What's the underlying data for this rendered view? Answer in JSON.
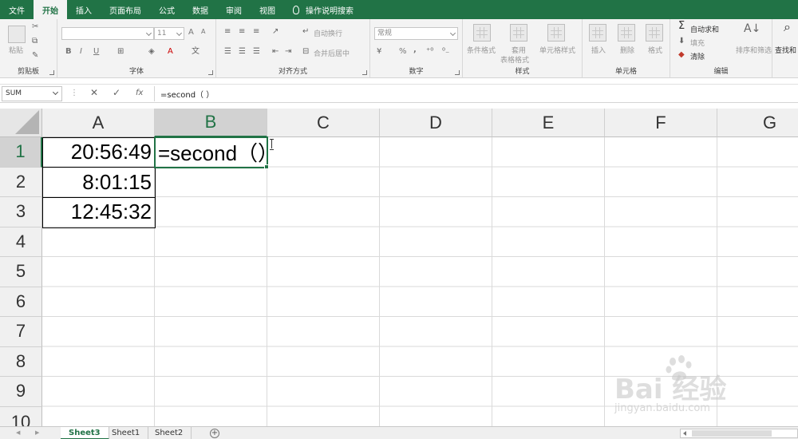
{
  "ribbon": {
    "tabs": [
      "文件",
      "开始",
      "插入",
      "页面布局",
      "公式",
      "数据",
      "审阅",
      "视图",
      "操作说明搜索"
    ],
    "active_tab": "开始",
    "groups": {
      "clipboard": {
        "label": "剪贴板",
        "paste": "粘贴"
      },
      "font": {
        "label": "字体",
        "size": "11",
        "bold": "B",
        "italic": "I",
        "underline": "U",
        "grow": "A",
        "shrink": "A",
        "font_color": "A"
      },
      "alignment": {
        "label": "对齐方式",
        "wrap": "自动换行",
        "merge": "合并后居中"
      },
      "number": {
        "label": "数字",
        "format": "常规",
        "percent": "%",
        "comma": ","
      },
      "styles": {
        "label": "样式",
        "conditional": "条件格式",
        "table_format_1": "套用",
        "table_format_2": "表格格式",
        "cell_styles": "单元格样式"
      },
      "cells": {
        "label": "单元格",
        "insert": "插入",
        "delete": "删除",
        "format": "格式"
      },
      "editing": {
        "label": "编辑",
        "autosum": "自动求和",
        "fill": "填充",
        "clear": "清除",
        "sort": "排序和筛选",
        "find": "查找和"
      }
    }
  },
  "formula_bar": {
    "name_box": "SUM",
    "cancel": "✕",
    "enter": "✓",
    "fx": "fx",
    "formula": "=second（ ）"
  },
  "grid": {
    "columns": [
      "A",
      "B",
      "C",
      "D",
      "E",
      "F",
      "G"
    ],
    "rows": [
      "1",
      "2",
      "3",
      "4",
      "5",
      "6",
      "7",
      "8",
      "9",
      "10"
    ],
    "selected_column": "B",
    "selected_row": "1",
    "cells": {
      "A1": "20:56:49",
      "A2": "8:01:15",
      "A3": "12:45:32",
      "B1": "=second（）"
    }
  },
  "sheets": {
    "tabs": [
      "Sheet3",
      "Sheet1",
      "Sheet2"
    ],
    "active": "Sheet3",
    "add": "+"
  },
  "watermark": {
    "brand": "Bai   经验",
    "domain": "jingyan.baidu.com"
  },
  "colors": {
    "accent": "#217346",
    "ribbon_bg": "#f3f3f3",
    "grid_line": "#dadada"
  }
}
